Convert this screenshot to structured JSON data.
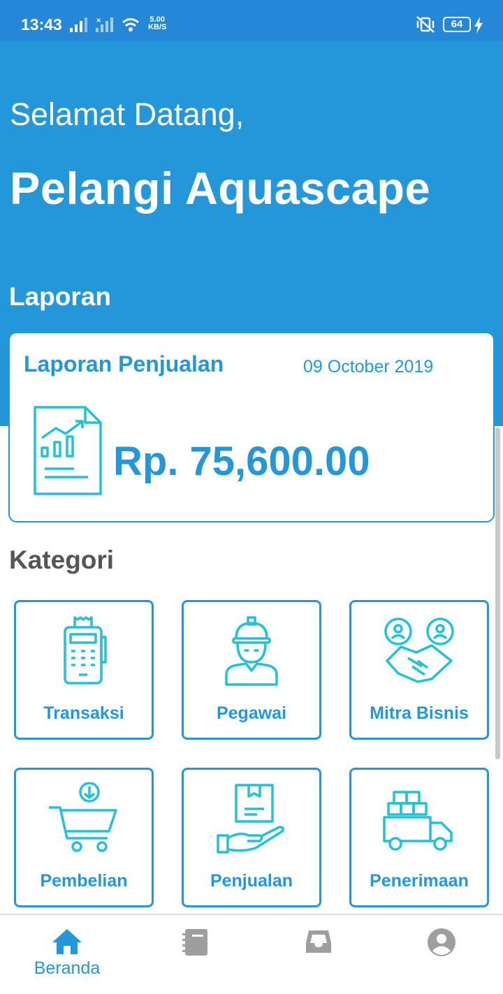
{
  "status_bar": {
    "time": "13:43",
    "speed_value": "5.00",
    "speed_unit": "KB/S",
    "battery": "64"
  },
  "header": {
    "greeting": "Selamat Datang,",
    "company": "Pelangi Aquascape",
    "section_title": "Laporan"
  },
  "report": {
    "title": "Laporan Penjualan",
    "date": "09 October 2019",
    "amount": "Rp. 75,600.00",
    "icon": "report-chart-icon"
  },
  "categories": {
    "title": "Kategori",
    "items": [
      {
        "label": "Transaksi",
        "icon": "pos-terminal-icon"
      },
      {
        "label": "Pegawai",
        "icon": "worker-icon"
      },
      {
        "label": "Mitra Bisnis",
        "icon": "handshake-icon"
      },
      {
        "label": "Pembelian",
        "icon": "shopping-cart-icon"
      },
      {
        "label": "Penjualan",
        "icon": "hand-box-icon"
      },
      {
        "label": "Penerimaan",
        "icon": "delivery-truck-icon"
      }
    ]
  },
  "bottom_nav": {
    "items": [
      {
        "label": "Beranda",
        "icon": "home-icon",
        "active": true
      },
      {
        "label": "",
        "icon": "notebook-icon",
        "active": false
      },
      {
        "label": "",
        "icon": "inbox-icon",
        "active": false
      },
      {
        "label": "",
        "icon": "profile-icon",
        "active": false
      }
    ]
  },
  "colors": {
    "primary": "#2497da",
    "status_bar": "#2587d8",
    "icon_cyan": "#22c1d8",
    "nav_inactive": "#9e9e9e",
    "section_title": "#555555"
  }
}
